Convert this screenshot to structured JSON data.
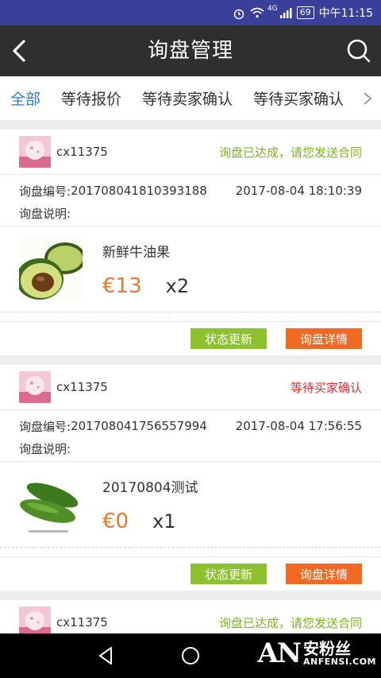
{
  "statusbar": {
    "network": "4G",
    "battery": "69",
    "time": "中午11:15"
  },
  "appbar": {
    "title": "询盘管理"
  },
  "tabs": [
    {
      "label": "全部",
      "active": true
    },
    {
      "label": "等待报价",
      "active": false
    },
    {
      "label": "等待卖家确认",
      "active": false
    },
    {
      "label": "等待买家确认",
      "active": false
    }
  ],
  "labels": {
    "inquiry_no": "询盘编号:",
    "inquiry_desc": "询盘说明:",
    "update_btn": "状态更新",
    "detail_btn": "询盘详情"
  },
  "colors": {
    "accent_blue": "#2b7fd0",
    "status_green": "#7cb518",
    "status_red": "#e03030",
    "price_orange": "#f0762a",
    "btn_green": "#8dc22d",
    "btn_orange": "#f16a22"
  },
  "cards": [
    {
      "user": "cx11375",
      "status": "询盘已达成，请您发送合同",
      "status_color": "#7cb518",
      "inquiry_no": "201708041810393188",
      "date": "2017-08-04 18:10:39",
      "product_name": "新鲜牛油果",
      "price": "€13",
      "qty": "x2",
      "image": "avocado"
    },
    {
      "user": "cx11375",
      "status": "等待买家确认",
      "status_color": "#e03030",
      "inquiry_no": "201708041756557994",
      "date": "2017-08-04 17:56:55",
      "product_name": "20170804测试",
      "price": "€0",
      "qty": "x1",
      "image": "cucumber"
    },
    {
      "user": "cx11375",
      "status": "询盘已达成，请您发送合同",
      "status_color": "#7cb518"
    }
  ],
  "watermark": {
    "logo": "AN",
    "cn": "安粉丝",
    "en": "ANFENSI.COM"
  }
}
